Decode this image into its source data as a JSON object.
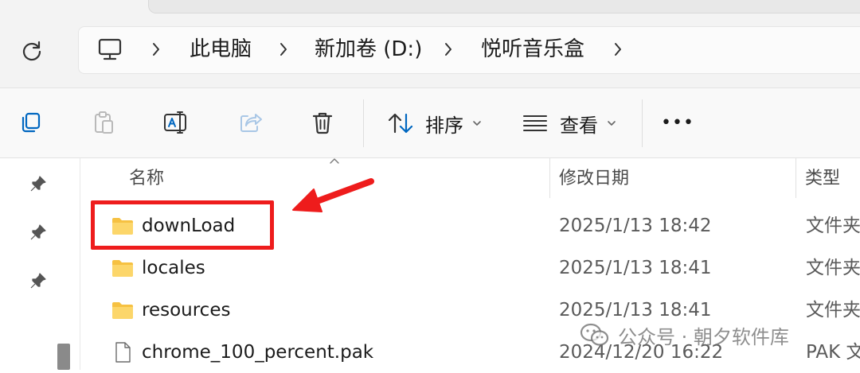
{
  "colors": {
    "accent": "#0067c0",
    "folder": "#f6c142",
    "annotation_red": "#ee1c1c"
  },
  "address_bar": {
    "breadcrumb": [
      "此电脑",
      "新加卷 (D:)",
      "悦听音乐盒"
    ],
    "root_icon": "computer-icon"
  },
  "toolbar": {
    "sort_label": "排序",
    "view_label": "查看",
    "more_label": "•••",
    "icons": [
      "copy-icon",
      "paste-icon",
      "rename-icon",
      "share-icon",
      "delete-icon",
      "sort-icon",
      "view-icon",
      "more-icon"
    ]
  },
  "columns": {
    "name": "名称",
    "modified": "修改日期",
    "type": "类型"
  },
  "files": [
    {
      "name": "downLoad",
      "modified": "2025/1/13 18:42",
      "type": "文件夹",
      "icon": "folder-icon"
    },
    {
      "name": "locales",
      "modified": "2025/1/13 18:41",
      "type": "文件夹",
      "icon": "folder-icon"
    },
    {
      "name": "resources",
      "modified": "2025/1/13 18:41",
      "type": "文件夹",
      "icon": "folder-icon"
    },
    {
      "name": "chrome_100_percent.pak",
      "modified": "2024/12/20 16:22",
      "type": "PAK 文",
      "icon": "file-icon"
    }
  ],
  "watermark": {
    "text": "公众号 · 朝夕软件库",
    "icon": "wechat-icon"
  }
}
